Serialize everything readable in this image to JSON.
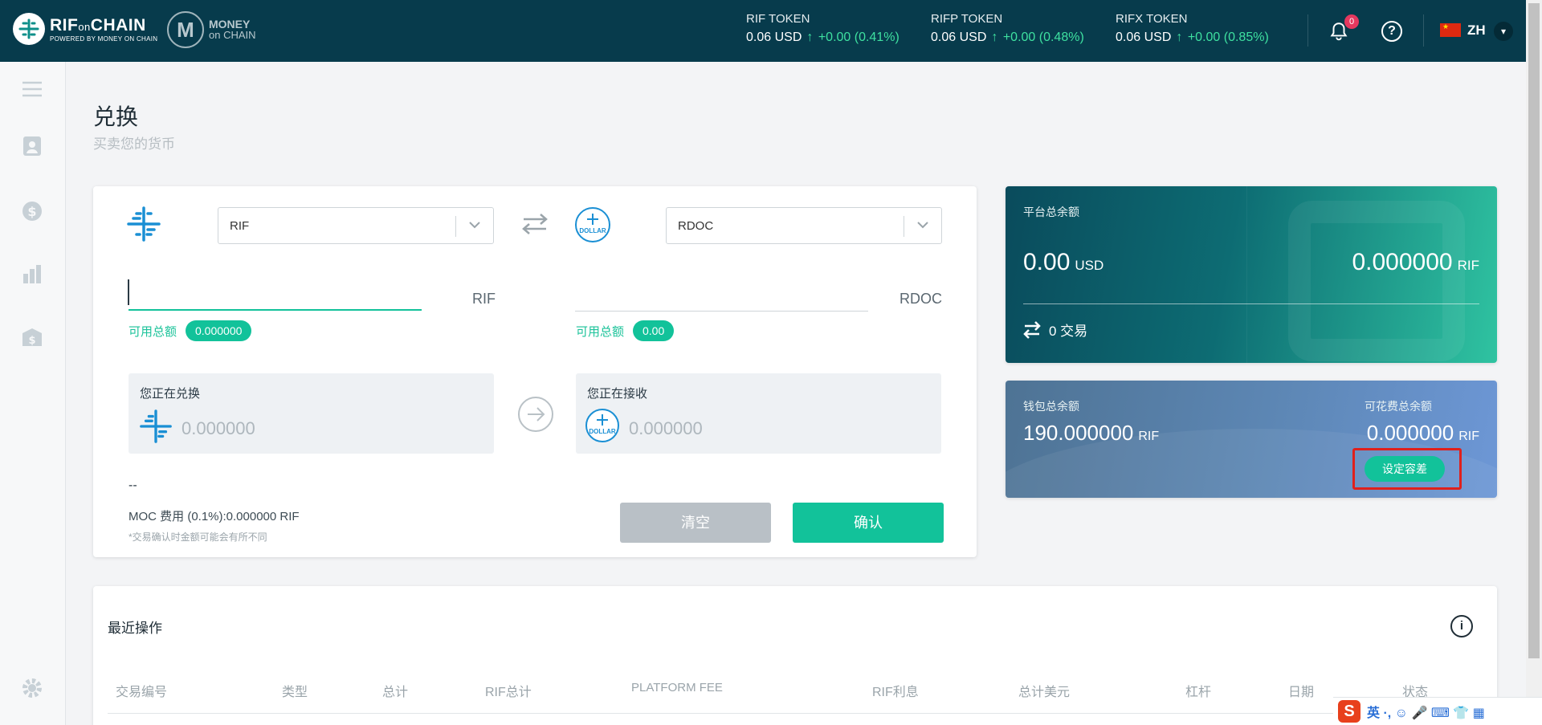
{
  "header": {
    "brand_main": "RIF",
    "brand_on": "on",
    "brand_chain": "CHAIN",
    "brand_tagline": "POWERED BY MONEY ON CHAIN",
    "brand2_line1": "MONEY",
    "brand2_line2": "on CHAIN",
    "tickers": [
      {
        "name": "RIF TOKEN",
        "price": "0.06 USD",
        "change": "+0.00 (0.41%)"
      },
      {
        "name": "RIFP TOKEN",
        "price": "0.06 USD",
        "change": "+0.00 (0.48%)"
      },
      {
        "name": "RIFX TOKEN",
        "price": "0.06 USD",
        "change": "+0.00 (0.85%)"
      }
    ],
    "notifications_count": "0",
    "help_symbol": "?",
    "language": "ZH"
  },
  "page": {
    "title": "兑换",
    "subtitle": "买卖您的货币"
  },
  "exchange": {
    "from_token": "RIF",
    "to_token": "RDOC",
    "from_unit": "RIF",
    "to_unit": "RDOC",
    "available_label": "可用总额",
    "from_available": "0.000000",
    "to_available": "0.00",
    "exchanging_label": "您正在兑换",
    "receiving_label": "您正在接收",
    "exchanging_value": "0.000000",
    "receiving_value": "0.000000",
    "dollar_label": "DOLLAR",
    "dash": "--",
    "fee": "MOC 费用 (0.1%):0.000000 RIF",
    "note": "*交易确认时金额可能会有所不同",
    "clear_label": "清空",
    "confirm_label": "确认"
  },
  "platform_balance": {
    "label": "平台总余额",
    "usd_value": "0.00",
    "usd_unit": "USD",
    "rif_value": "0.000000",
    "rif_unit": "RIF",
    "tx_count": "0 交易"
  },
  "wallet_balance": {
    "label": "钱包总余额",
    "value": "190.000000",
    "unit": "RIF",
    "spendable_label": "可花费总余额",
    "spendable_value": "0.000000",
    "spendable_unit": "RIF",
    "tolerance_button": "设定容差"
  },
  "recent": {
    "title": "最近操作",
    "info_symbol": "i",
    "columns": [
      "交易编号",
      "类型",
      "总计",
      "RIF总计",
      "PLATFORM FEE",
      "RIF利息",
      "总计美元",
      "杠杆",
      "日期",
      "状态"
    ]
  },
  "ime": {
    "logo": "S",
    "items": "英 ·, ☺ 🎤 ⌨ 👕 ▦"
  },
  "colors": {
    "topbar": "#073b4c",
    "accent": "#12c29a",
    "highlight_box": "#e0201c"
  }
}
